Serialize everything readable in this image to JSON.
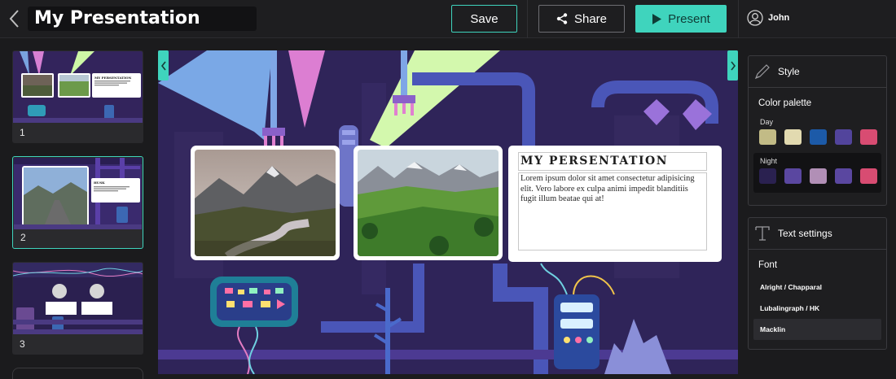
{
  "header": {
    "title": "My Presentation",
    "save_label": "Save",
    "share_label": "Share",
    "present_label": "Present",
    "user_name": "John"
  },
  "thumbnails": [
    {
      "number": "1",
      "title": "MY PERSENTATION"
    },
    {
      "number": "2",
      "title": "HUSK"
    },
    {
      "number": "3"
    }
  ],
  "slide": {
    "title": "MY PERSENTATION",
    "body": "Lorem ipsum dolor sit amet consectetur adipisicing elit. Vero labore ex culpa animi impedit blanditiis fugit illum beatae qui at!"
  },
  "style_panel": {
    "heading": "Style",
    "palette_label": "Color palette",
    "day_label": "Day",
    "night_label": "Night",
    "day_colors": [
      "#c2bb86",
      "#e2dab0",
      "#1c5aa8",
      "#52449c",
      "#d84c72"
    ],
    "night_colors": [
      "#2a2150",
      "#5a47a0",
      "#b18fb6",
      "#5a47a0",
      "#d84c72"
    ]
  },
  "text_panel": {
    "heading": "Text settings",
    "font_label": "Font",
    "fonts": [
      "Alright / Chapparal",
      "Lubalingraph / HK",
      "Macklin"
    ],
    "selected_font": "Macklin"
  },
  "colors": {
    "accent": "#3fd4bd",
    "background": "#1b1b1d",
    "canvas": "#2a1e52"
  }
}
